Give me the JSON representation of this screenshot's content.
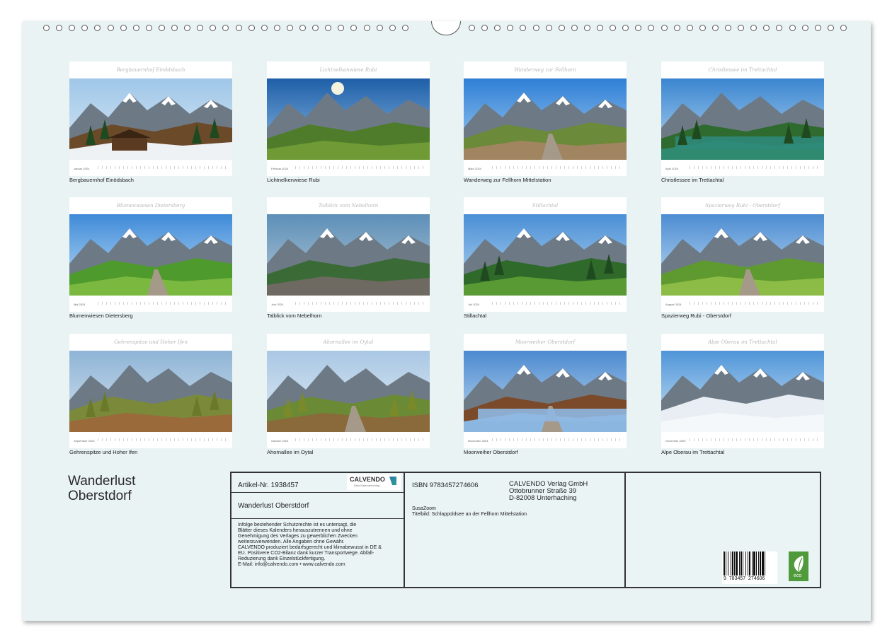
{
  "calendar": {
    "title_line1": "Wanderlust",
    "title_line2": "Oberstdorf"
  },
  "months": [
    {
      "script_title": "Bergbauernhof Einödsbach",
      "month_label": "Januar 2024",
      "caption": "Bergbauernhof Einödsbach",
      "scene": "alpine-farmhouse-snow"
    },
    {
      "script_title": "Lichtnelkenwiese Rubi",
      "month_label": "Februar 2024",
      "caption": "Lichtnelkenwiese Rubi",
      "scene": "flower-meadow-sunburst"
    },
    {
      "script_title": "Wanderweg zur Fellhorn",
      "month_label": "März 2024",
      "caption": "Wanderweg zur Fellhorn Mittelstation",
      "scene": "hiking-path-mountains"
    },
    {
      "script_title": "Christlessee im Trettachtal",
      "month_label": "April 2024",
      "caption": "Christlessee im Trettachtal",
      "scene": "mountain-lake"
    },
    {
      "script_title": "Blumenwiesen Dietersberg",
      "month_label": "Mai 2024",
      "caption": "Blumenwiesen Dietersberg",
      "scene": "valley-path"
    },
    {
      "script_title": "Talblick vom Nebelhorn",
      "month_label": "Juni 2024",
      "caption": "Talblick vom Nebelhorn",
      "scene": "valley-view-summit"
    },
    {
      "script_title": "Stillachtal",
      "month_label": "Juli 2024",
      "caption": "Stillachtal",
      "scene": "green-valley"
    },
    {
      "script_title": "Spazierweg Rubi - Oberstdorf",
      "month_label": "August 2024",
      "caption": "Spazierweg Rubi - Oberstdorf",
      "scene": "meadow-walkway"
    },
    {
      "script_title": "Gehrenspitze und Hoher Ifen",
      "month_label": "September 2024",
      "caption": "Gehrenspitze und Hoher Ifen",
      "scene": "autumn-ridge"
    },
    {
      "script_title": "Ahornallee im Oytal",
      "month_label": "Oktober 2024",
      "caption": "Ahornallee im Oytal",
      "scene": "tree-avenue"
    },
    {
      "script_title": "Moorweiher Oberstdorf",
      "month_label": "November 2024",
      "caption": "Moorweiher Oberstdorf",
      "scene": "frozen-pond"
    },
    {
      "script_title": "Alpe Oberau im Trettachtal",
      "month_label": "Dezember 2024",
      "caption": "Alpe Oberau im Trettachtal",
      "scene": "winter-valley"
    }
  ],
  "info": {
    "article": "Artikel-Nr. 1938457",
    "logo_text": "CALVENDO",
    "logo_sub": "Dein Kalenderverlag",
    "product_title": "Wanderlust Oberstdorf",
    "legal": [
      "Infolge bestehender Schutzrechte ist es untersagt, die",
      "Blätter dieses Kalenders herauszutrennen und ohne",
      "Genehmigung des Verlages zu gewerblichen Zwecken",
      "weiterzuverwenden. Alle Angaben ohne Gewähr.",
      "CALVENDO produziert bedarfsgerecht und klimabewusst in DE &",
      "EU. Positivere CO2-Bilanz dank kurzer Transportwege. Abfall-",
      "Reduzierung dank Einzelstückfertigung.",
      "E-Mail: info@calvendo.com • www.calvendo.com"
    ],
    "isbn": "ISBN 9783457274606",
    "publisher_1": "CALVENDO Verlag GmbH",
    "publisher_2": "Ottobrunner Straße 39",
    "publisher_3": "D-82008 Unterhaching",
    "author": "SusaZoom",
    "cover": "Titelbild: Schlappoldsee an der Fellhorn Mittelstation",
    "barcode_digits": "9  783457  274606",
    "eco_label": "eco"
  }
}
